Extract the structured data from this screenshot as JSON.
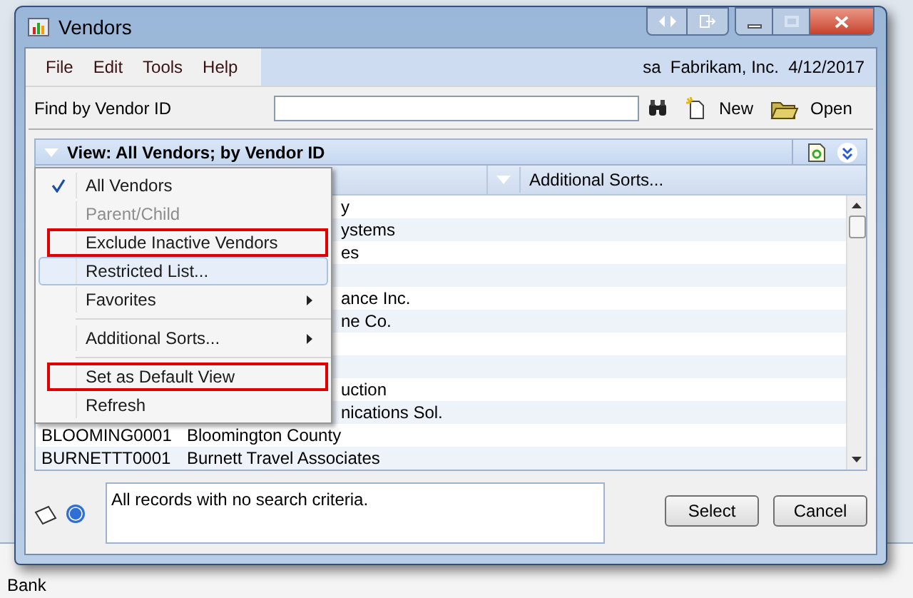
{
  "window": {
    "title": "Vendors"
  },
  "menu_bar": [
    {
      "label": "File"
    },
    {
      "label": "Edit"
    },
    {
      "label": "Tools"
    },
    {
      "label": "Help"
    }
  ],
  "user_info": "sa  Fabrikam, Inc.  4/12/2017",
  "find": {
    "label": "Find by Vendor ID"
  },
  "toolbar": [
    {
      "kind": "search"
    },
    {
      "kind": "new",
      "label": "New"
    },
    {
      "kind": "open",
      "label": "Open"
    }
  ],
  "view_bar": {
    "title": "View: All Vendors; by Vendor ID"
  },
  "columns": [
    {
      "label": "Additional Sorts..."
    }
  ],
  "rows": [
    {
      "name": "y"
    },
    {
      "name": "ystems"
    },
    {
      "name": "es"
    },
    {},
    {
      "name": "ance Inc."
    },
    {
      "name": "ne Co."
    },
    {},
    {},
    {
      "name": "uction"
    },
    {
      "name": "nications Sol."
    },
    {
      "id": "BLOOMING0001",
      "name": "Bloomington County"
    },
    {
      "id": "BURNETTT0001",
      "name": "Burnett Travel Associates"
    }
  ],
  "view_menu": [
    {
      "kind": "item",
      "label": "All Vendors",
      "checked": true,
      "disabled": false,
      "hovered": false,
      "annotated": false,
      "submenu": false
    },
    {
      "kind": "item",
      "label": "Parent/Child",
      "checked": false,
      "disabled": true,
      "hovered": false,
      "annotated": false,
      "submenu": false
    },
    {
      "kind": "item",
      "label": "Exclude Inactive Vendors",
      "checked": false,
      "disabled": false,
      "hovered": false,
      "annotated": true,
      "submenu": false
    },
    {
      "kind": "item",
      "label": "Restricted List...",
      "checked": false,
      "disabled": false,
      "hovered": true,
      "annotated": false,
      "submenu": false
    },
    {
      "kind": "item",
      "label": "Favorites",
      "checked": false,
      "disabled": false,
      "hovered": false,
      "annotated": false,
      "submenu": true
    },
    {
      "kind": "separator"
    },
    {
      "kind": "item",
      "label": "Additional Sorts...",
      "checked": false,
      "disabled": false,
      "hovered": false,
      "annotated": false,
      "submenu": true
    },
    {
      "kind": "separator"
    },
    {
      "kind": "item",
      "label": "Set as Default View",
      "checked": false,
      "disabled": false,
      "hovered": false,
      "annotated": true,
      "submenu": false
    },
    {
      "kind": "item",
      "label": "Refresh",
      "checked": false,
      "disabled": false,
      "hovered": false,
      "annotated": false,
      "submenu": false
    }
  ],
  "status_text": "All records with no search criteria.",
  "buttons": [
    {
      "label": "Select"
    },
    {
      "label": "Cancel"
    }
  ],
  "background_window": {
    "label": "Bank"
  }
}
